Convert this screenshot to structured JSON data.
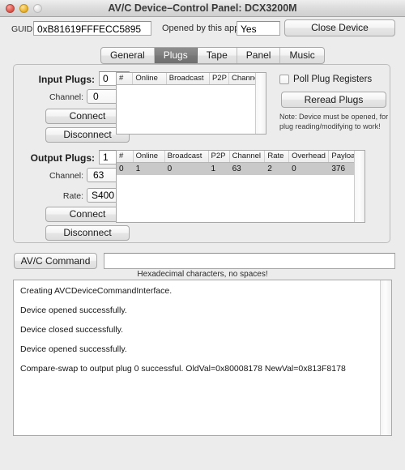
{
  "window": {
    "title": "AV/C Device–Control Panel: DCX3200M",
    "controls": {
      "close": "close",
      "minimize": "minimize",
      "zoom": "zoom"
    }
  },
  "device": {
    "guid_label": "GUID:",
    "guid_value": "0xB81619FFFECC5895",
    "opened_label": "Opened by this app?",
    "opened_value": "Yes",
    "close_device_button": "Close Device"
  },
  "tabs": [
    {
      "label": "General",
      "active": false
    },
    {
      "label": "Plugs",
      "active": true
    },
    {
      "label": "Tape",
      "active": false
    },
    {
      "label": "Panel",
      "active": false
    },
    {
      "label": "Music",
      "active": false
    }
  ],
  "input_plugs": {
    "title": "Input Plugs:",
    "count_value": "0",
    "channel_label": "Channel:",
    "channel_value": "0",
    "connect_button": "Connect",
    "disconnect_button": "Disconnect",
    "columns": [
      "#",
      "Online",
      "Broadcast",
      "P2P",
      "Channel"
    ],
    "rows": []
  },
  "output_plugs": {
    "title": "Output Plugs:",
    "count_value": "1",
    "channel_label": "Channel:",
    "channel_value": "63",
    "rate_label": "Rate:",
    "rate_value": "S400",
    "connect_button": "Connect",
    "disconnect_button": "Disconnect",
    "columns": [
      "#",
      "Online",
      "Broadcast",
      "P2P",
      "Channel",
      "Rate",
      "Overhead",
      "Payload"
    ],
    "rows": [
      {
        "selected": true,
        "cells": [
          "0",
          "1",
          "0",
          "1",
          "63",
          "2",
          "0",
          "376"
        ]
      }
    ]
  },
  "plug_options": {
    "poll_checkbox_label": "Poll Plug Registers",
    "poll_checked": false,
    "reread_button": "Reread Plugs",
    "note": "Note: Device must be opened, for plug reading/modifying to work!"
  },
  "avc_command": {
    "button": "AV/C Command",
    "input_value": "",
    "input_placeholder": "",
    "hint": "Hexadecimal characters, no spaces!"
  },
  "log": {
    "lines": [
      "Creating AVCDeviceCommandInterface.",
      "Device opened successfully.",
      "Device closed successfully.",
      "Device opened successfully.",
      "Compare-swap to output plug 0 successful. OldVal=0x80008178 NewVal=0x813F8178"
    ]
  },
  "colors": {
    "window_background": "#ececec",
    "active_tab": "#7e7e7e",
    "selected_row": "#c9c9c9",
    "field_background": "#ffffff"
  }
}
